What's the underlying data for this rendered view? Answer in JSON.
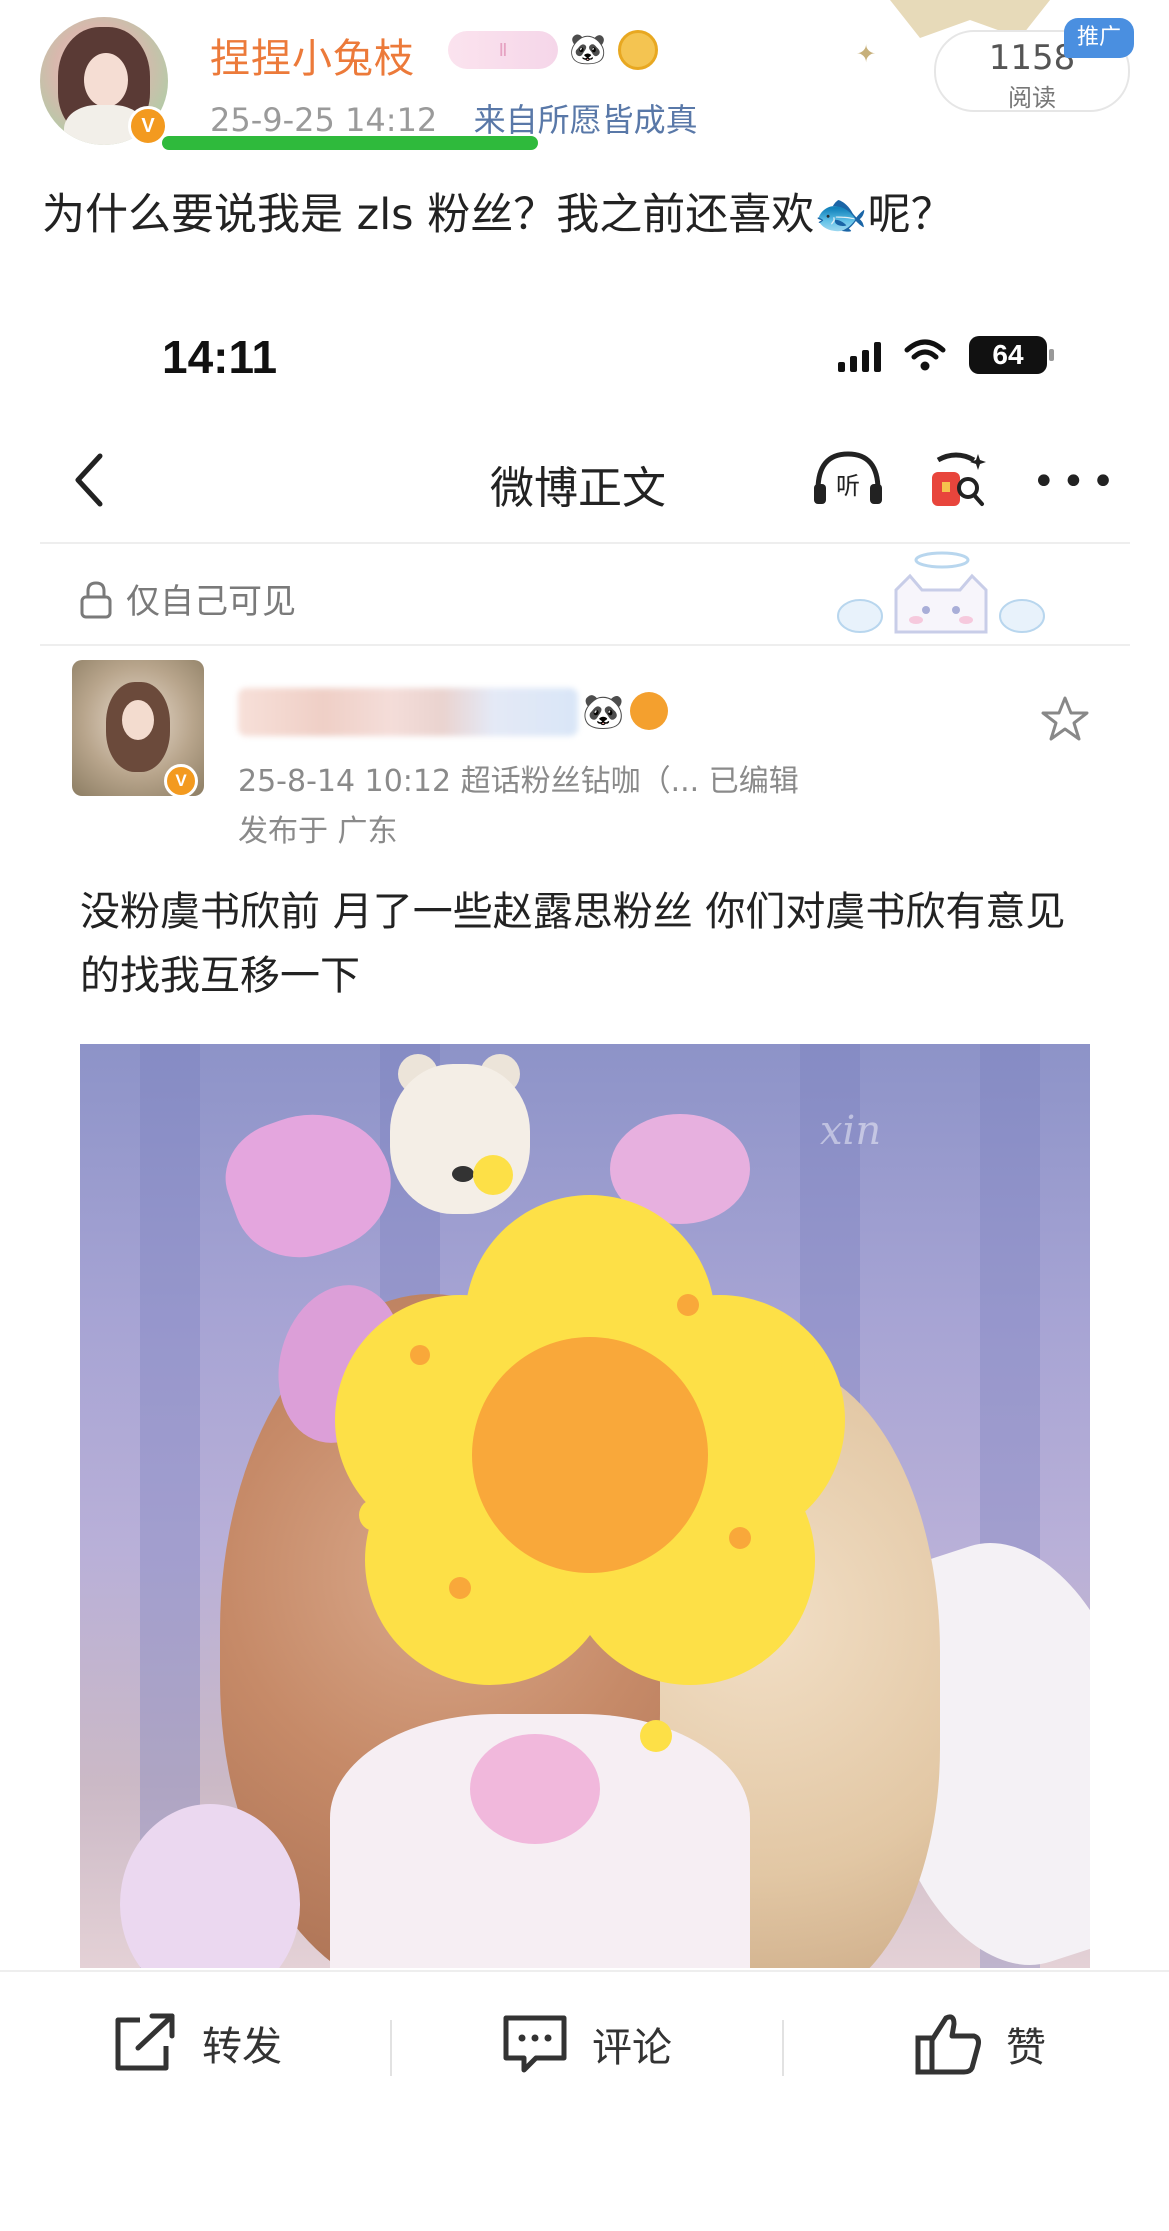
{
  "post": {
    "username": "捏捏小兔枝",
    "timestamp": "25-9-25 14:12",
    "source": "来自所愿皆成真",
    "views_count": "1158",
    "views_label": "阅读",
    "promo_label": "推广",
    "text": "为什么要说我是 zls 粉丝？我之前还喜欢🐟呢？",
    "badge_text": "Ⅱ",
    "panda_emoji": "🐼"
  },
  "embedded": {
    "status_time": "14:11",
    "battery": "64",
    "nav_title": "微博正文",
    "listen_label": "听",
    "visibility": "仅自己可见",
    "inner_post": {
      "panda_emoji": "🐼",
      "meta": "25-8-14 10:12  超话粉丝钻咖（...   已编辑",
      "location": "发布于 广东",
      "text": "没粉虞书欣前 月了一些赵露思粉丝 你们对虞书欣有意见的找我互移一下",
      "photo_watermark": "xin"
    }
  },
  "actions": {
    "repost": "转发",
    "comment": "评论",
    "like": "赞"
  },
  "colors": {
    "username": "#ec7a3a",
    "source_link": "#5978a8",
    "verified_badge": "#f39a1f",
    "underline_highlight": "#2fba3c",
    "promo_tag": "#4a8fe0",
    "flower_petal": "#fde047",
    "flower_center": "#f9a83a"
  }
}
